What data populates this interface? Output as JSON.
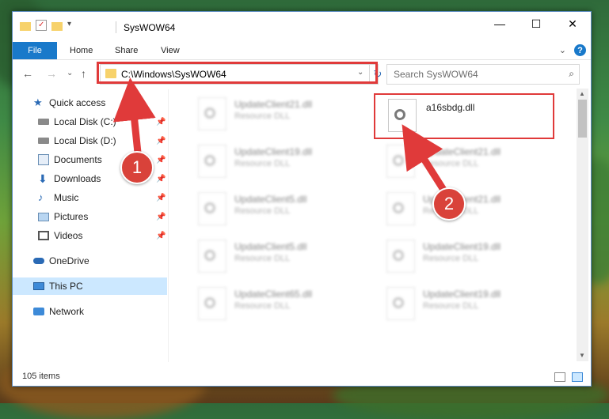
{
  "window": {
    "title": "SysWOW64",
    "controls": {
      "minimize": "—",
      "maximize": "☐",
      "close": "✕"
    }
  },
  "ribbon": {
    "tabs": [
      "File",
      "Home",
      "Share",
      "View"
    ],
    "help": "?",
    "expand": "⌄"
  },
  "nav": {
    "back": "←",
    "forward": "→",
    "recent": "⌄",
    "up": "↑",
    "address": "C:\\Windows\\SysWOW64",
    "address_dropdown": "⌄",
    "refresh": "↻",
    "search_placeholder": "Search SysWOW64",
    "search_icon": "⌕"
  },
  "sidebar": {
    "items": [
      {
        "label": "Quick access",
        "icon": "star-icon",
        "pinned": false
      },
      {
        "label": "Local Disk (C:)",
        "icon": "drive-icon",
        "pinned": true
      },
      {
        "label": "Local Disk (D:)",
        "icon": "drive-icon",
        "pinned": true
      },
      {
        "label": "Documents",
        "icon": "documents-icon",
        "pinned": true
      },
      {
        "label": "Downloads",
        "icon": "downloads-icon",
        "pinned": true
      },
      {
        "label": "Music",
        "icon": "music-icon",
        "pinned": true
      },
      {
        "label": "Pictures",
        "icon": "pictures-icon",
        "pinned": true
      },
      {
        "label": "Videos",
        "icon": "videos-icon",
        "pinned": true
      },
      {
        "label": "OneDrive",
        "icon": "cloud-icon",
        "pinned": false
      },
      {
        "label": "This PC",
        "icon": "computer-icon",
        "pinned": false,
        "selected": true
      },
      {
        "label": "Network",
        "icon": "network-icon",
        "pinned": false
      }
    ],
    "pin_glyph": "📌"
  },
  "files": {
    "highlighted": {
      "name": "a16sbdg.dll",
      "type": ""
    },
    "items": [
      {
        "name": "UpdateClient21.dll",
        "type": "Resource DLL"
      },
      {
        "name": "UpdateClient19.dll",
        "type": "Resource DLL"
      },
      {
        "name": "UpdateClient21.dll",
        "type": "Resource DLL"
      },
      {
        "name": "UpdateClient5.dll",
        "type": "Resource DLL"
      },
      {
        "name": "UpdateClient21.dll",
        "type": "Resource DLL"
      },
      {
        "name": "UpdateClient5.dll",
        "type": "Resource DLL"
      },
      {
        "name": "UpdateClient19.dll",
        "type": "Resource DLL"
      },
      {
        "name": "UpdateClient65.dll",
        "type": "Resource DLL"
      },
      {
        "name": "UpdateClient19.dll",
        "type": "Resource DLL"
      }
    ]
  },
  "status": {
    "count": "105 items"
  },
  "annotations": {
    "badge1": "1",
    "badge2": "2"
  },
  "colors": {
    "accent": "#1979ca",
    "highlight": "#e03a3a",
    "selected": "#cce8ff"
  }
}
